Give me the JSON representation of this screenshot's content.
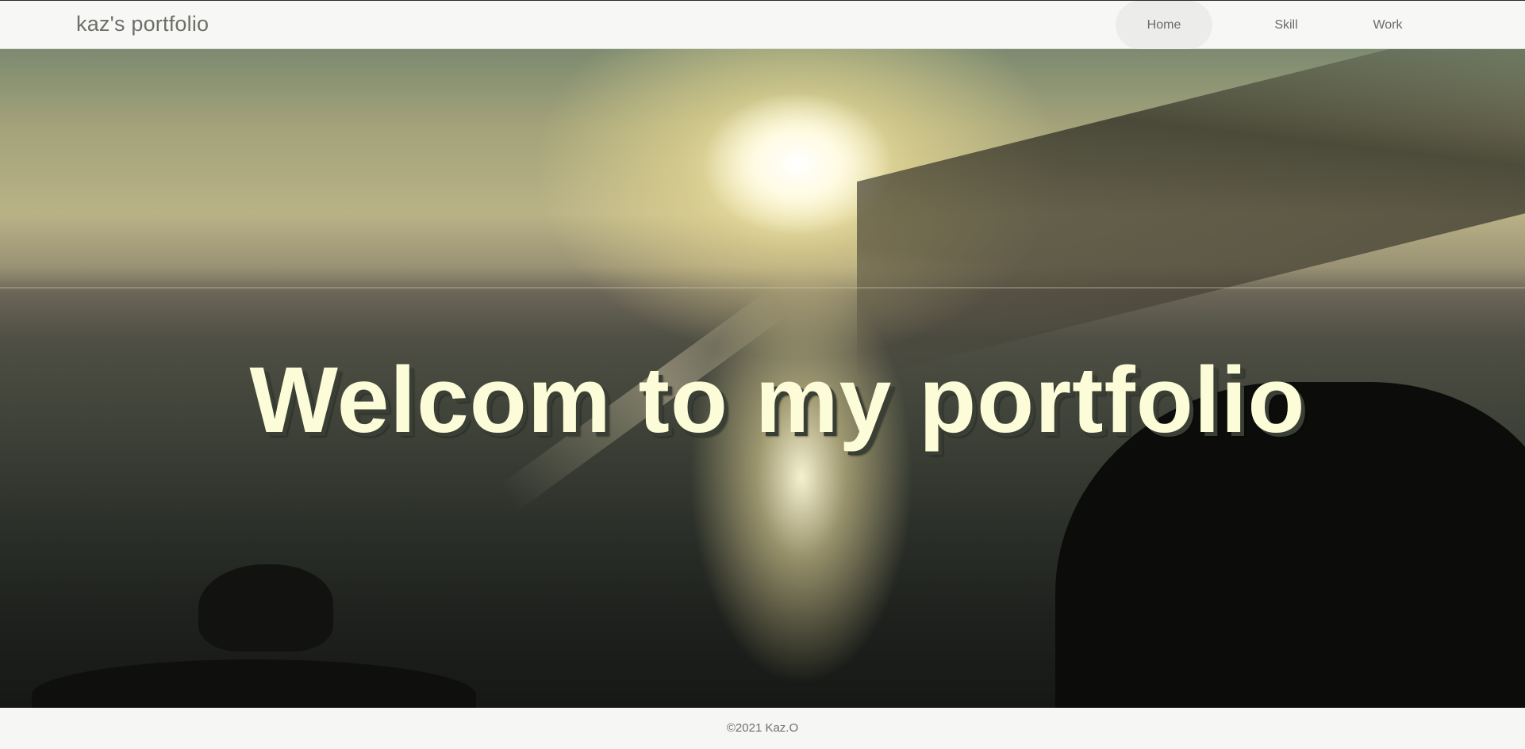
{
  "header": {
    "brand": "kaz's portfolio",
    "nav": [
      {
        "label": "Home",
        "active": true
      },
      {
        "label": "Skill",
        "active": false
      },
      {
        "label": "Work",
        "active": false
      }
    ]
  },
  "hero": {
    "title": "Welcom to my portfolio"
  },
  "footer": {
    "copyright": "©2021 Kaz.O"
  },
  "colors": {
    "header_bg": "#f7f7f5",
    "active_nav_bg": "#ececea",
    "hero_text": "#fdfcd8",
    "text_muted": "#6e6e6a"
  }
}
